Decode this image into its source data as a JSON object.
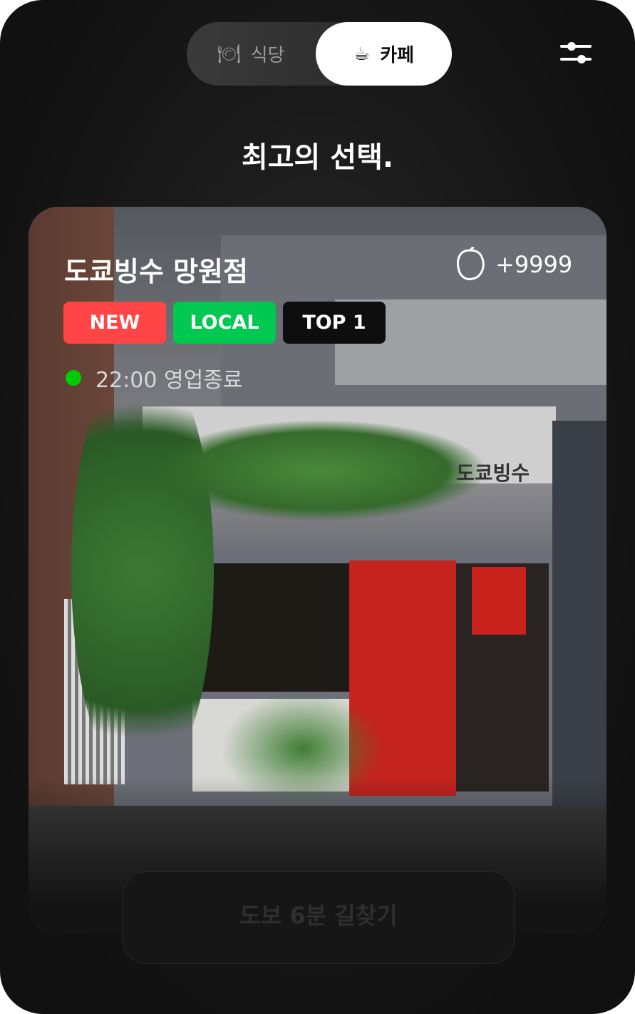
{
  "tabs": [
    {
      "icon": "🍽",
      "label": "식당",
      "selected": false
    },
    {
      "icon": "☕",
      "label": "카페",
      "selected": true
    }
  ],
  "heading": "최고의 선택.",
  "card": {
    "name": "도쿄빙수 망원점",
    "like_count": "+9999",
    "tags": [
      {
        "label": "NEW",
        "color": "#ff4545"
      },
      {
        "label": "LOCAL",
        "color": "#00c850"
      },
      {
        "label": "TOP 1",
        "color": "#0e0e0e"
      }
    ],
    "status_color": "#00c800",
    "hours": "22:00 영업종료",
    "sign_text": "도쿄빙수"
  },
  "cta": "도보 6분 길찾기"
}
